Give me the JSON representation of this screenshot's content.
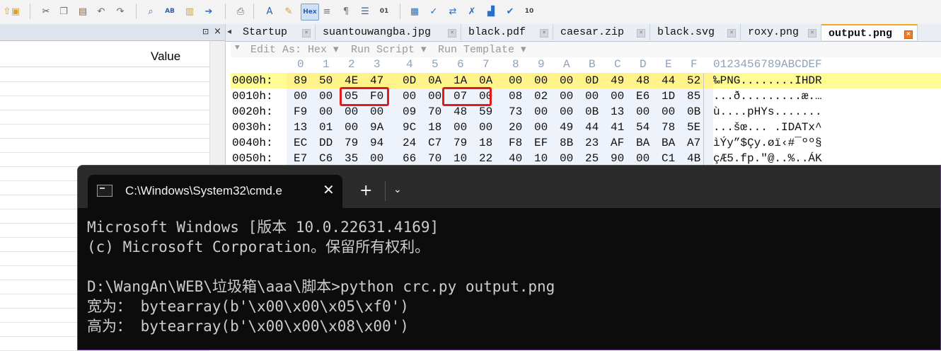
{
  "toolbar": {
    "icons": [
      {
        "name": "folder-up-icon",
        "glyph": "⇧",
        "color": "#e0a020"
      },
      {
        "name": "open-folder-icon",
        "glyph": "▣",
        "color": "#d8a030"
      },
      {
        "name": "cut-icon",
        "glyph": "✂",
        "color": "#555555"
      },
      {
        "name": "copy-icon",
        "glyph": "❐",
        "color": "#777777"
      },
      {
        "name": "paste-icon",
        "glyph": "▤",
        "color": "#8a6a3a"
      },
      {
        "name": "undo-icon",
        "glyph": "↶",
        "color": "#666666"
      },
      {
        "name": "redo-icon",
        "glyph": "↷",
        "color": "#666666"
      },
      {
        "name": "find-icon",
        "glyph": "⌕",
        "color": "#3a6fb0"
      },
      {
        "name": "find-replace-icon",
        "glyph": "AB",
        "color": "#2a5fb0"
      },
      {
        "name": "find-in-files-icon",
        "glyph": "▥",
        "color": "#c8a040"
      },
      {
        "name": "goto-icon",
        "glyph": "➔",
        "color": "#2a70c8"
      },
      {
        "name": "print-icon",
        "glyph": "⎙",
        "color": "#666666"
      },
      {
        "name": "font-icon",
        "glyph": "A",
        "color": "#2a5fb0"
      },
      {
        "name": "highlighter-icon",
        "glyph": "✎",
        "color": "#c8a040"
      },
      {
        "name": "hex-toggle-icon",
        "glyph": "Hex",
        "color": "#2a5fb0"
      },
      {
        "name": "word-wrap-icon",
        "glyph": "≡",
        "color": "#777777"
      },
      {
        "name": "show-spaces-icon",
        "glyph": "¶",
        "color": "#777777"
      },
      {
        "name": "column-mode-icon",
        "glyph": "☰",
        "color": "#2a5fb0"
      },
      {
        "name": "binary-icon",
        "glyph": "01",
        "color": "#444444"
      },
      {
        "name": "calculator-icon",
        "glyph": "▦",
        "color": "#2a70c8"
      },
      {
        "name": "check-icon",
        "glyph": "✓",
        "color": "#2a70c8"
      },
      {
        "name": "compare-icon",
        "glyph": "⇄",
        "color": "#2a70c8"
      },
      {
        "name": "tools-icon",
        "glyph": "✗",
        "color": "#2a70c8"
      },
      {
        "name": "chart-icon",
        "glyph": "▟",
        "color": "#2a70c8"
      },
      {
        "name": "checklist-icon",
        "glyph": "✔",
        "color": "#2a70c8"
      },
      {
        "name": "number-base-icon",
        "glyph": "10",
        "color": "#444444"
      }
    ]
  },
  "left_pane": {
    "pin_icon": "⊡",
    "close_icon": "×",
    "column_value_label": "Value"
  },
  "tabs": [
    {
      "label": "Startup",
      "active": false
    },
    {
      "label": "suantouwangba.jpg",
      "active": false
    },
    {
      "label": "black.pdf",
      "active": false
    },
    {
      "label": "caesar.zip",
      "active": false
    },
    {
      "label": "black.svg",
      "active": false
    },
    {
      "label": "roxy.png",
      "active": false
    },
    {
      "label": "output.png",
      "active": true
    }
  ],
  "subbar": {
    "edit_as": "Edit As: Hex",
    "run_script": "Run Script",
    "run_template": "Run Template"
  },
  "hex": {
    "column_headers": [
      "0",
      "1",
      "2",
      "3",
      "4",
      "5",
      "6",
      "7",
      "8",
      "9",
      "A",
      "B",
      "C",
      "D",
      "E",
      "F"
    ],
    "ascii_header": "0123456789ABCDEF",
    "rows": [
      {
        "addr": "0000h:",
        "bytes": [
          "89",
          "50",
          "4E",
          "47",
          "0D",
          "0A",
          "1A",
          "0A",
          "00",
          "00",
          "00",
          "0D",
          "49",
          "48",
          "44",
          "52"
        ],
        "ascii": "‰PNG........IHDR"
      },
      {
        "addr": "0010h:",
        "bytes": [
          "00",
          "00",
          "05",
          "F0",
          "00",
          "00",
          "07",
          "00",
          "08",
          "02",
          "00",
          "00",
          "00",
          "E6",
          "1D",
          "85"
        ],
        "ascii": "...ð.........æ.…"
      },
      {
        "addr": "0020h:",
        "bytes": [
          "F9",
          "00",
          "00",
          "00",
          "09",
          "70",
          "48",
          "59",
          "73",
          "00",
          "00",
          "0B",
          "13",
          "00",
          "00",
          "0B"
        ],
        "ascii": "ù....pHYs......."
      },
      {
        "addr": "0030h:",
        "bytes": [
          "13",
          "01",
          "00",
          "9A",
          "9C",
          "18",
          "00",
          "00",
          "20",
          "00",
          "49",
          "44",
          "41",
          "54",
          "78",
          "5E"
        ],
        "ascii": "...šœ... .IDATx^"
      },
      {
        "addr": "0040h:",
        "bytes": [
          "EC",
          "DD",
          "79",
          "94",
          "24",
          "C7",
          "79",
          "18",
          "F8",
          "EF",
          "8B",
          "23",
          "AF",
          "BA",
          "BA",
          "A7"
        ],
        "ascii": "ìÝy”$Çy.øï‹#¯ºº§"
      },
      {
        "addr": "0050h:",
        "bytes": [
          "E7",
          "C6",
          "35",
          "00",
          "66",
          "70",
          "10",
          "22",
          "40",
          "10",
          "00",
          "25",
          "90",
          "00",
          "C1",
          "4B"
        ],
        "ascii": "çÆ5.fp.\"@..%..ÁK"
      }
    ]
  },
  "terminal": {
    "tab_title": "C:\\Windows\\System32\\cmd.e",
    "close_icon": "✕",
    "new_tab_icon": "+",
    "dropdown_icon": "⌄",
    "lines": [
      "Microsoft Windows [版本 10.0.22631.4169]",
      "(c) Microsoft Corporation。保留所有权利。",
      "",
      "D:\\WangAn\\WEB\\垃圾箱\\aaa\\脚本>python crc.py output.png",
      "宽为： bytearray(b'\\x00\\x00\\x05\\xf0')",
      "高为： bytearray(b'\\x00\\x00\\x08\\x00')"
    ]
  },
  "colors": {
    "highlight_row": "#fffb95",
    "annotation_red": "#e01b1b",
    "terminal_bg": "#0c0c0c",
    "active_tab_accent": "#f5a623"
  }
}
